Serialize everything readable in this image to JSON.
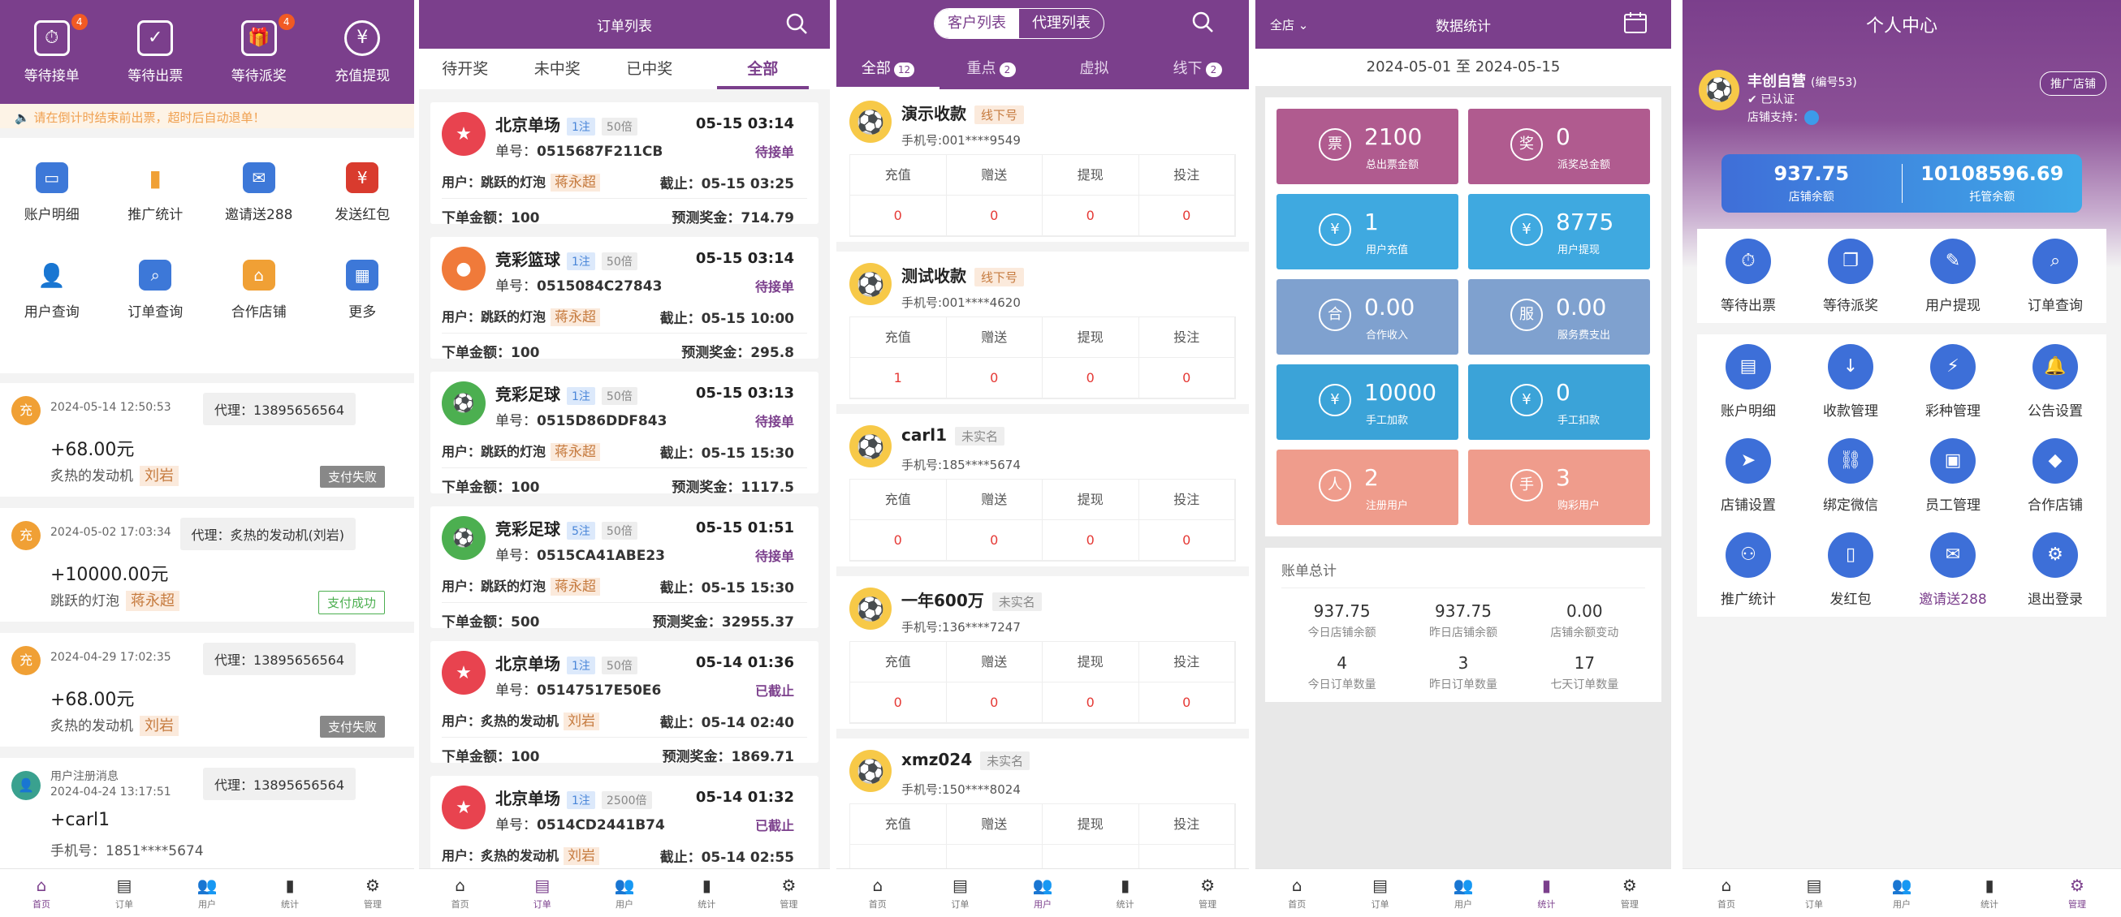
{
  "tabbar": [
    "首页",
    "订单",
    "用户",
    "统计",
    "管理"
  ],
  "p1": {
    "top": [
      {
        "label": "等待接单",
        "badge": "4"
      },
      {
        "label": "等待出票",
        "badge": ""
      },
      {
        "label": "等待派奖",
        "badge": "4"
      },
      {
        "label": "充值提现",
        "badge": ""
      }
    ],
    "notice": "请在倒计时结束前出票，超时后自动退单！",
    "grid": [
      "账户明细",
      "推广统计",
      "邀请送288",
      "发送红包",
      "用户查询",
      "订单查询",
      "合作店铺",
      "更多"
    ],
    "feed": [
      {
        "icon": "充",
        "time": "2024-05-14 12:50:53",
        "agent": "代理：13895656564",
        "amount": "+68.00元",
        "user": "炙热的发动机",
        "name": "刘岩",
        "status": "支付失败",
        "ok": false
      },
      {
        "icon": "充",
        "time": "2024-05-02 17:03:34",
        "agent": "代理：炙热的发动机(刘岩)",
        "amount": "+10000.00元",
        "user": "跳跃的灯泡",
        "name": "蒋永超",
        "status": "支付成功",
        "ok": true
      },
      {
        "icon": "充",
        "time": "2024-04-29 17:02:35",
        "agent": "代理：13895656564",
        "amount": "+68.00元",
        "user": "炙热的发动机",
        "name": "刘岩",
        "status": "支付失败",
        "ok": false
      },
      {
        "icon": "",
        "time": "用户注册消息",
        "time2": "2024-04-24 13:17:51",
        "agent": "代理：13895656564",
        "amount": "+carl1",
        "user": "手机号：1851****5674",
        "name": "",
        "status": "",
        "ok": false
      }
    ]
  },
  "p2": {
    "title": "订单列表",
    "tabs": [
      "待开奖",
      "未中奖",
      "已中奖",
      "全部"
    ],
    "orders": [
      {
        "name": "北京单场",
        "mult": "1注",
        "bei": "50倍",
        "date": "05-15 03:14",
        "no_label": "单号：",
        "no": "0515687F211CB",
        "status": "待接单",
        "user": "用户：跳跃的灯泡",
        "uname": "蒋永超",
        "cut": "截止：05-15 03:25",
        "amt": "下单金额：100",
        "pred": "预测奖金：714.79",
        "logo": "bj"
      },
      {
        "name": "竞彩篮球",
        "mult": "1注",
        "bei": "50倍",
        "date": "05-15 03:14",
        "no_label": "单号：",
        "no": "0515084C27843",
        "status": "待接单",
        "user": "用户：跳跃的灯泡",
        "uname": "蒋永超",
        "cut": "截止：05-15 10:00",
        "amt": "下单金额：100",
        "pred": "预测奖金：295.8",
        "logo": "bk"
      },
      {
        "name": "竞彩足球",
        "mult": "1注",
        "bei": "50倍",
        "date": "05-15 03:13",
        "no_label": "单号：",
        "no": "0515D86DDF843",
        "status": "待接单",
        "user": "用户：跳跃的灯泡",
        "uname": "蒋永超",
        "cut": "截止：05-15 15:30",
        "amt": "下单金额：100",
        "pred": "预测奖金：1117.5",
        "logo": "fb"
      },
      {
        "name": "竞彩足球",
        "mult": "5注",
        "bei": "50倍",
        "date": "05-15 01:51",
        "no_label": "单号：",
        "no": "0515CA41ABE23",
        "status": "待接单",
        "user": "用户：跳跃的灯泡",
        "uname": "蒋永超",
        "cut": "截止：05-15 15:30",
        "amt": "下单金额：500",
        "pred": "预测奖金：32955.37",
        "logo": "fb"
      },
      {
        "name": "北京单场",
        "mult": "1注",
        "bei": "50倍",
        "date": "05-14 01:36",
        "no_label": "单号：",
        "no": "05147517E50E6",
        "status": "已截止",
        "user": "用户：炙热的发动机",
        "uname": "刘岩",
        "cut": "截止：05-14 02:40",
        "amt": "下单金额：100",
        "pred": "预测奖金：1869.71",
        "logo": "bj"
      },
      {
        "name": "北京单场",
        "mult": "1注",
        "bei": "2500倍",
        "date": "05-14 01:32",
        "no_label": "单号：",
        "no": "0514CD2441B74",
        "status": "已截止",
        "user": "用户：炙热的发动机",
        "uname": "刘岩",
        "cut": "截止：05-14 02:55",
        "amt": "",
        "pred": "",
        "logo": "bj"
      }
    ]
  },
  "p3": {
    "seg": [
      "客户列表",
      "代理列表"
    ],
    "ftabs": [
      {
        "label": "全部",
        "badge": "12"
      },
      {
        "label": "重点",
        "badge": "2"
      },
      {
        "label": "虚拟",
        "badge": ""
      },
      {
        "label": "线下",
        "badge": "2"
      }
    ],
    "cols": [
      "充值",
      "赠送",
      "提现",
      "投注"
    ],
    "customers": [
      {
        "name": "演示收款",
        "tag": "线下号",
        "tagType": "o",
        "phone": "手机号:001****9549",
        "vals": [
          "0",
          "0",
          "0",
          "0"
        ]
      },
      {
        "name": "测试收款",
        "tag": "线下号",
        "tagType": "o",
        "phone": "手机号:001****4620",
        "vals": [
          "1",
          "0",
          "0",
          "0"
        ]
      },
      {
        "name": "carl1",
        "tag": "未实名",
        "tagType": "g",
        "phone": "手机号:185****5674",
        "vals": [
          "0",
          "0",
          "0",
          "0"
        ]
      },
      {
        "name": "一年600万",
        "tag": "未实名",
        "tagType": "g",
        "phone": "手机号:136****7247",
        "vals": [
          "0",
          "0",
          "0",
          "0"
        ]
      },
      {
        "name": "xmz024",
        "tag": "未实名",
        "tagType": "g",
        "phone": "手机号:150****8024",
        "vals": [
          "",
          "",
          "",
          ""
        ]
      }
    ]
  },
  "p4": {
    "left": "全店",
    "title": "数据统计",
    "date": "2024-05-01 至 2024-05-15",
    "cards": [
      {
        "value": "2100",
        "label": "总出票金额",
        "color": "#b05b8f",
        "icon": "票"
      },
      {
        "value": "0",
        "label": "派奖总金额",
        "color": "#b05b8f",
        "icon": "奖"
      },
      {
        "value": "1",
        "label": "用户充值",
        "color": "#3fa9e0",
        "icon": "¥"
      },
      {
        "value": "8775",
        "label": "用户提现",
        "color": "#3fa9e0",
        "icon": "¥"
      },
      {
        "value": "0.00",
        "label": "合作收入",
        "color": "#7fa1cf",
        "icon": "合"
      },
      {
        "value": "0.00",
        "label": "服务费支出",
        "color": "#7fa1cf",
        "icon": "服"
      },
      {
        "value": "10000",
        "label": "手工加款",
        "color": "#3ba3d8",
        "icon": "¥"
      },
      {
        "value": "0",
        "label": "手工扣款",
        "color": "#3ba3d8",
        "icon": "¥"
      },
      {
        "value": "2",
        "label": "注册用户",
        "color": "#ef9c8c",
        "icon": "人"
      },
      {
        "value": "3",
        "label": "购彩用户",
        "color": "#ef9c8c",
        "icon": "手"
      }
    ],
    "sum_title": "账单总计",
    "sum": [
      {
        "n": "937.75",
        "l": "今日店铺余额"
      },
      {
        "n": "937.75",
        "l": "昨日店铺余额"
      },
      {
        "n": "0.00",
        "l": "店铺余额变动"
      },
      {
        "n": "4",
        "l": "今日订单数量"
      },
      {
        "n": "3",
        "l": "昨日订单数量"
      },
      {
        "n": "17",
        "l": "七天订单数量"
      }
    ]
  },
  "p5": {
    "title": "个人中心",
    "uname": "丰创自营",
    "uid": "(编号53)",
    "cert": "已认证",
    "pay": "店铺支持：",
    "promo": "推广店铺",
    "bal1": "937.75",
    "bal1_l": "店铺余额",
    "bal2": "10108596.69",
    "bal2_l": "托管余额",
    "menu1": [
      "等待出票",
      "等待派奖",
      "用户提现",
      "订单查询"
    ],
    "menu2": [
      "账户明细",
      "收款管理",
      "彩种管理",
      "公告设置",
      "店铺设置",
      "绑定微信",
      "员工管理",
      "合作店铺",
      "推广统计",
      "发红包",
      "邀请送288",
      "退出登录"
    ]
  }
}
